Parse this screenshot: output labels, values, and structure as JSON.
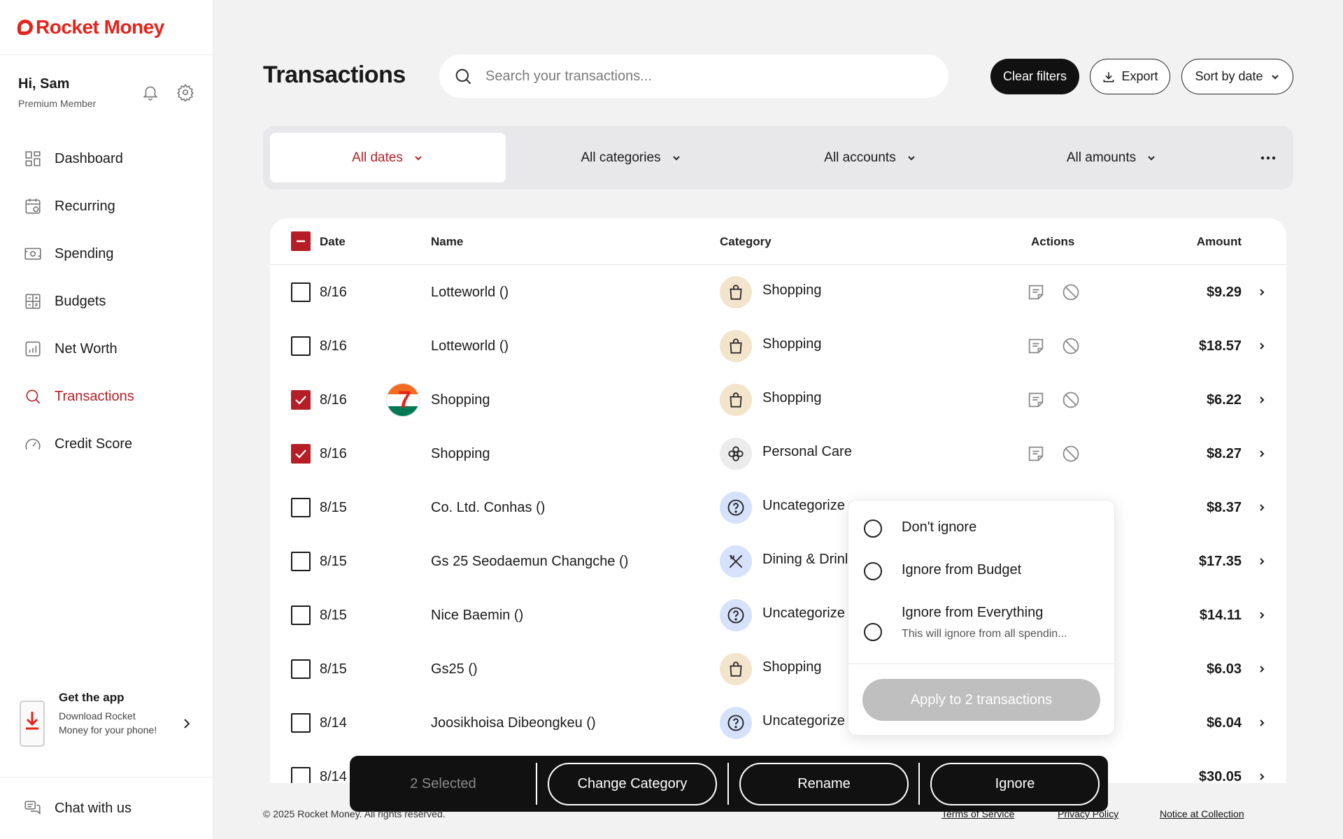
{
  "brand": {
    "name": "Rocket Money",
    "color": "#e5231b",
    "accent": "#b51e26"
  },
  "user": {
    "greeting": "Hi, Sam",
    "tier": "Premium Member"
  },
  "nav": [
    {
      "label": "Dashboard",
      "icon": "dashboard-icon"
    },
    {
      "label": "Recurring",
      "icon": "calendar-recurring-icon"
    },
    {
      "label": "Spending",
      "icon": "money-icon"
    },
    {
      "label": "Budgets",
      "icon": "calculator-icon"
    },
    {
      "label": "Net Worth",
      "icon": "bar-chart-icon"
    },
    {
      "label": "Transactions",
      "icon": "search-icon",
      "active": true
    },
    {
      "label": "Credit Score",
      "icon": "gauge-icon"
    }
  ],
  "getapp": {
    "title": "Get the app",
    "subtitle": "Download Rocket Money for your phone!"
  },
  "chat": {
    "label": "Chat with us"
  },
  "header": {
    "title": "Transactions",
    "search_placeholder": "Search your transactions...",
    "clear_label": "Clear filters",
    "export_label": "Export",
    "sort_label": "Sort by date"
  },
  "filters": {
    "dates": "All dates",
    "categories": "All categories",
    "accounts": "All accounts",
    "amounts": "All amounts"
  },
  "table": {
    "columns": {
      "date": "Date",
      "name": "Name",
      "category": "Category",
      "actions": "Actions",
      "amount": "Amount"
    },
    "rows": [
      {
        "date": "8/16",
        "name": "Lotteworld ()",
        "category": "Shopping",
        "amount": "$9.29"
      },
      {
        "date": "8/16",
        "name": "Lotteworld ()",
        "category": "Shopping",
        "amount": "$18.57"
      },
      {
        "date": "8/16",
        "name": "Shopping",
        "category": "Shopping",
        "amount": "$6.22",
        "checked": true,
        "logo": "7eleven-logo"
      },
      {
        "date": "8/16",
        "name": "Shopping",
        "category": "Personal Care",
        "amount": "$8.27",
        "checked": true
      },
      {
        "date": "8/15",
        "name": "Co. Ltd. Conhas ()",
        "category": "Uncategorize",
        "amount": "$8.37"
      },
      {
        "date": "8/15",
        "name": "Gs 25 Seodaemun Changche ()",
        "category": "Dining & Drinl",
        "amount": "$17.35"
      },
      {
        "date": "8/15",
        "name": "Nice Baemin ()",
        "category": "Uncategorize",
        "amount": "$14.11"
      },
      {
        "date": "8/15",
        "name": "Gs25 ()",
        "category": "Shopping",
        "amount": "$6.03"
      },
      {
        "date": "8/14",
        "name": "Joosikhoisa Dibeongkeu ()",
        "category": "Uncategorize",
        "amount": "$6.04"
      },
      {
        "date": "8/14",
        "name": "",
        "category": "",
        "amount": "$30.05"
      }
    ]
  },
  "ignore_popover": {
    "options": [
      {
        "label": "Don't ignore"
      },
      {
        "label": "Ignore from Budget"
      },
      {
        "label": "Ignore from Everything",
        "subtitle": "This will ignore from all spendin..."
      }
    ],
    "apply_label": "Apply to 2 transactions"
  },
  "actionbar": {
    "selected": "2 Selected",
    "change_category": "Change Category",
    "rename": "Rename",
    "ignore": "Ignore"
  },
  "footer": {
    "copyright": "© 2025 Rocket Money. All rights reserved.",
    "terms": "Terms of Service",
    "privacy": "Privacy Policy",
    "notice": "Notice at Collection"
  },
  "category_colors": {
    "shopping": "#f3e4cc",
    "personal_care": "#ececec",
    "uncategorized": "#d6e1fb",
    "dining": "#d6e1fb"
  }
}
